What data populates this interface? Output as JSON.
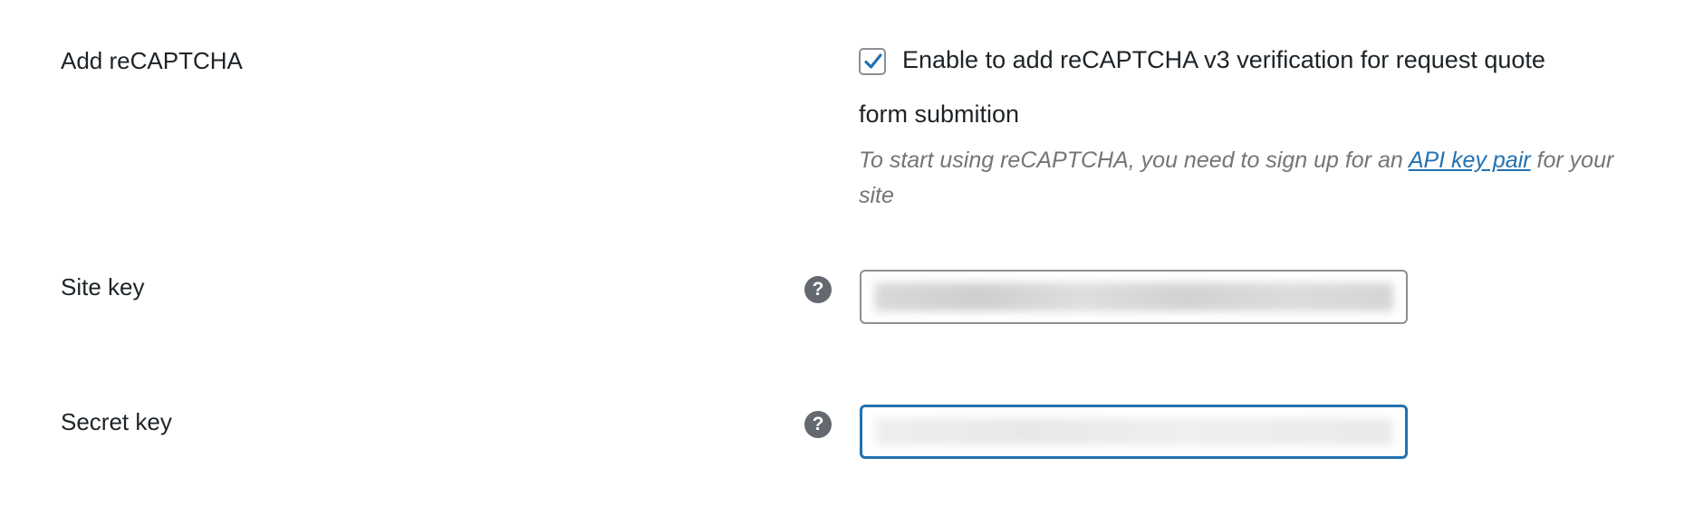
{
  "recaptcha_row": {
    "label": "Add reCAPTCHA",
    "checkbox_checked": true,
    "checkbox_text_line1": "Enable to add reCAPTCHA v3 verification for request quote",
    "checkbox_text_line2": "form submition",
    "description_before": "To start using reCAPTCHA, you need to sign up for an ",
    "description_link": "API key pair",
    "description_after": " for your site"
  },
  "site_key_row": {
    "label": "Site key",
    "help_icon": "question-mark-circle-icon",
    "help_glyph": "?"
  },
  "secret_key_row": {
    "label": "Secret key",
    "help_icon": "question-mark-circle-icon",
    "help_glyph": "?"
  },
  "colors": {
    "text": "#1d2327",
    "description": "#757575",
    "link": "#2271b1",
    "focus_border": "#2271b1",
    "input_border": "#8c8f94",
    "help_icon_bg": "#646970"
  }
}
